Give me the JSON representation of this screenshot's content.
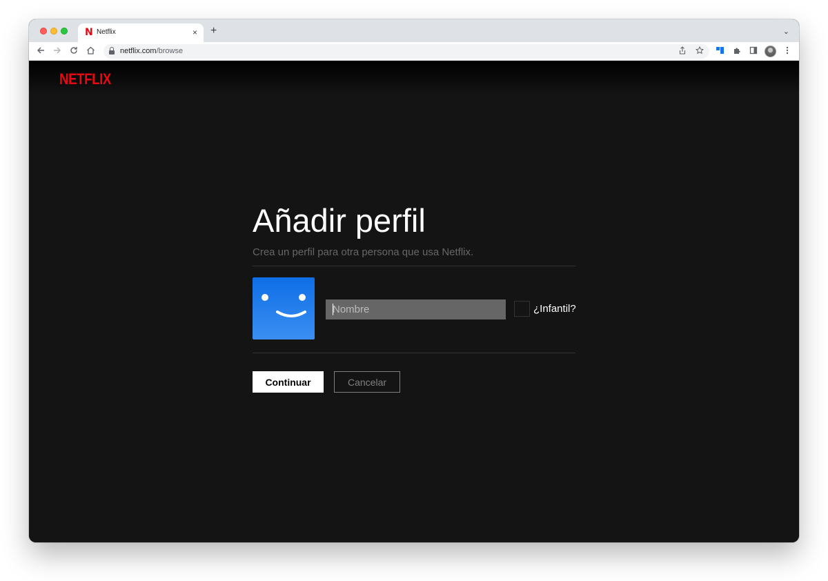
{
  "browser": {
    "tab_title": "Netflix",
    "tab_favicon": "N",
    "tab_close": "×",
    "new_tab": "+",
    "tab_search": "⌄",
    "url_host": "netflix.com",
    "url_path": "/browse",
    "icons": [
      "back-icon",
      "forward-icon",
      "reload-icon",
      "home-icon",
      "lock-icon",
      "share-icon",
      "star-icon",
      "extension-icon",
      "puzzle-icon",
      "sidepanel-icon",
      "avatar",
      "more-icon"
    ]
  },
  "netflix": {
    "logo": "NETFLIX",
    "title": "Añadir perfil",
    "subtitle": "Crea un perfil para otra persona que usa Netflix.",
    "name_placeholder": "Nombre",
    "kids_label": "¿Infantil?",
    "continue_label": "Continuar",
    "cancel_label": "Cancelar"
  },
  "colors": {
    "background": "#141414",
    "brand_red": "#e50914",
    "avatar_blue": "#0f6ee6"
  }
}
